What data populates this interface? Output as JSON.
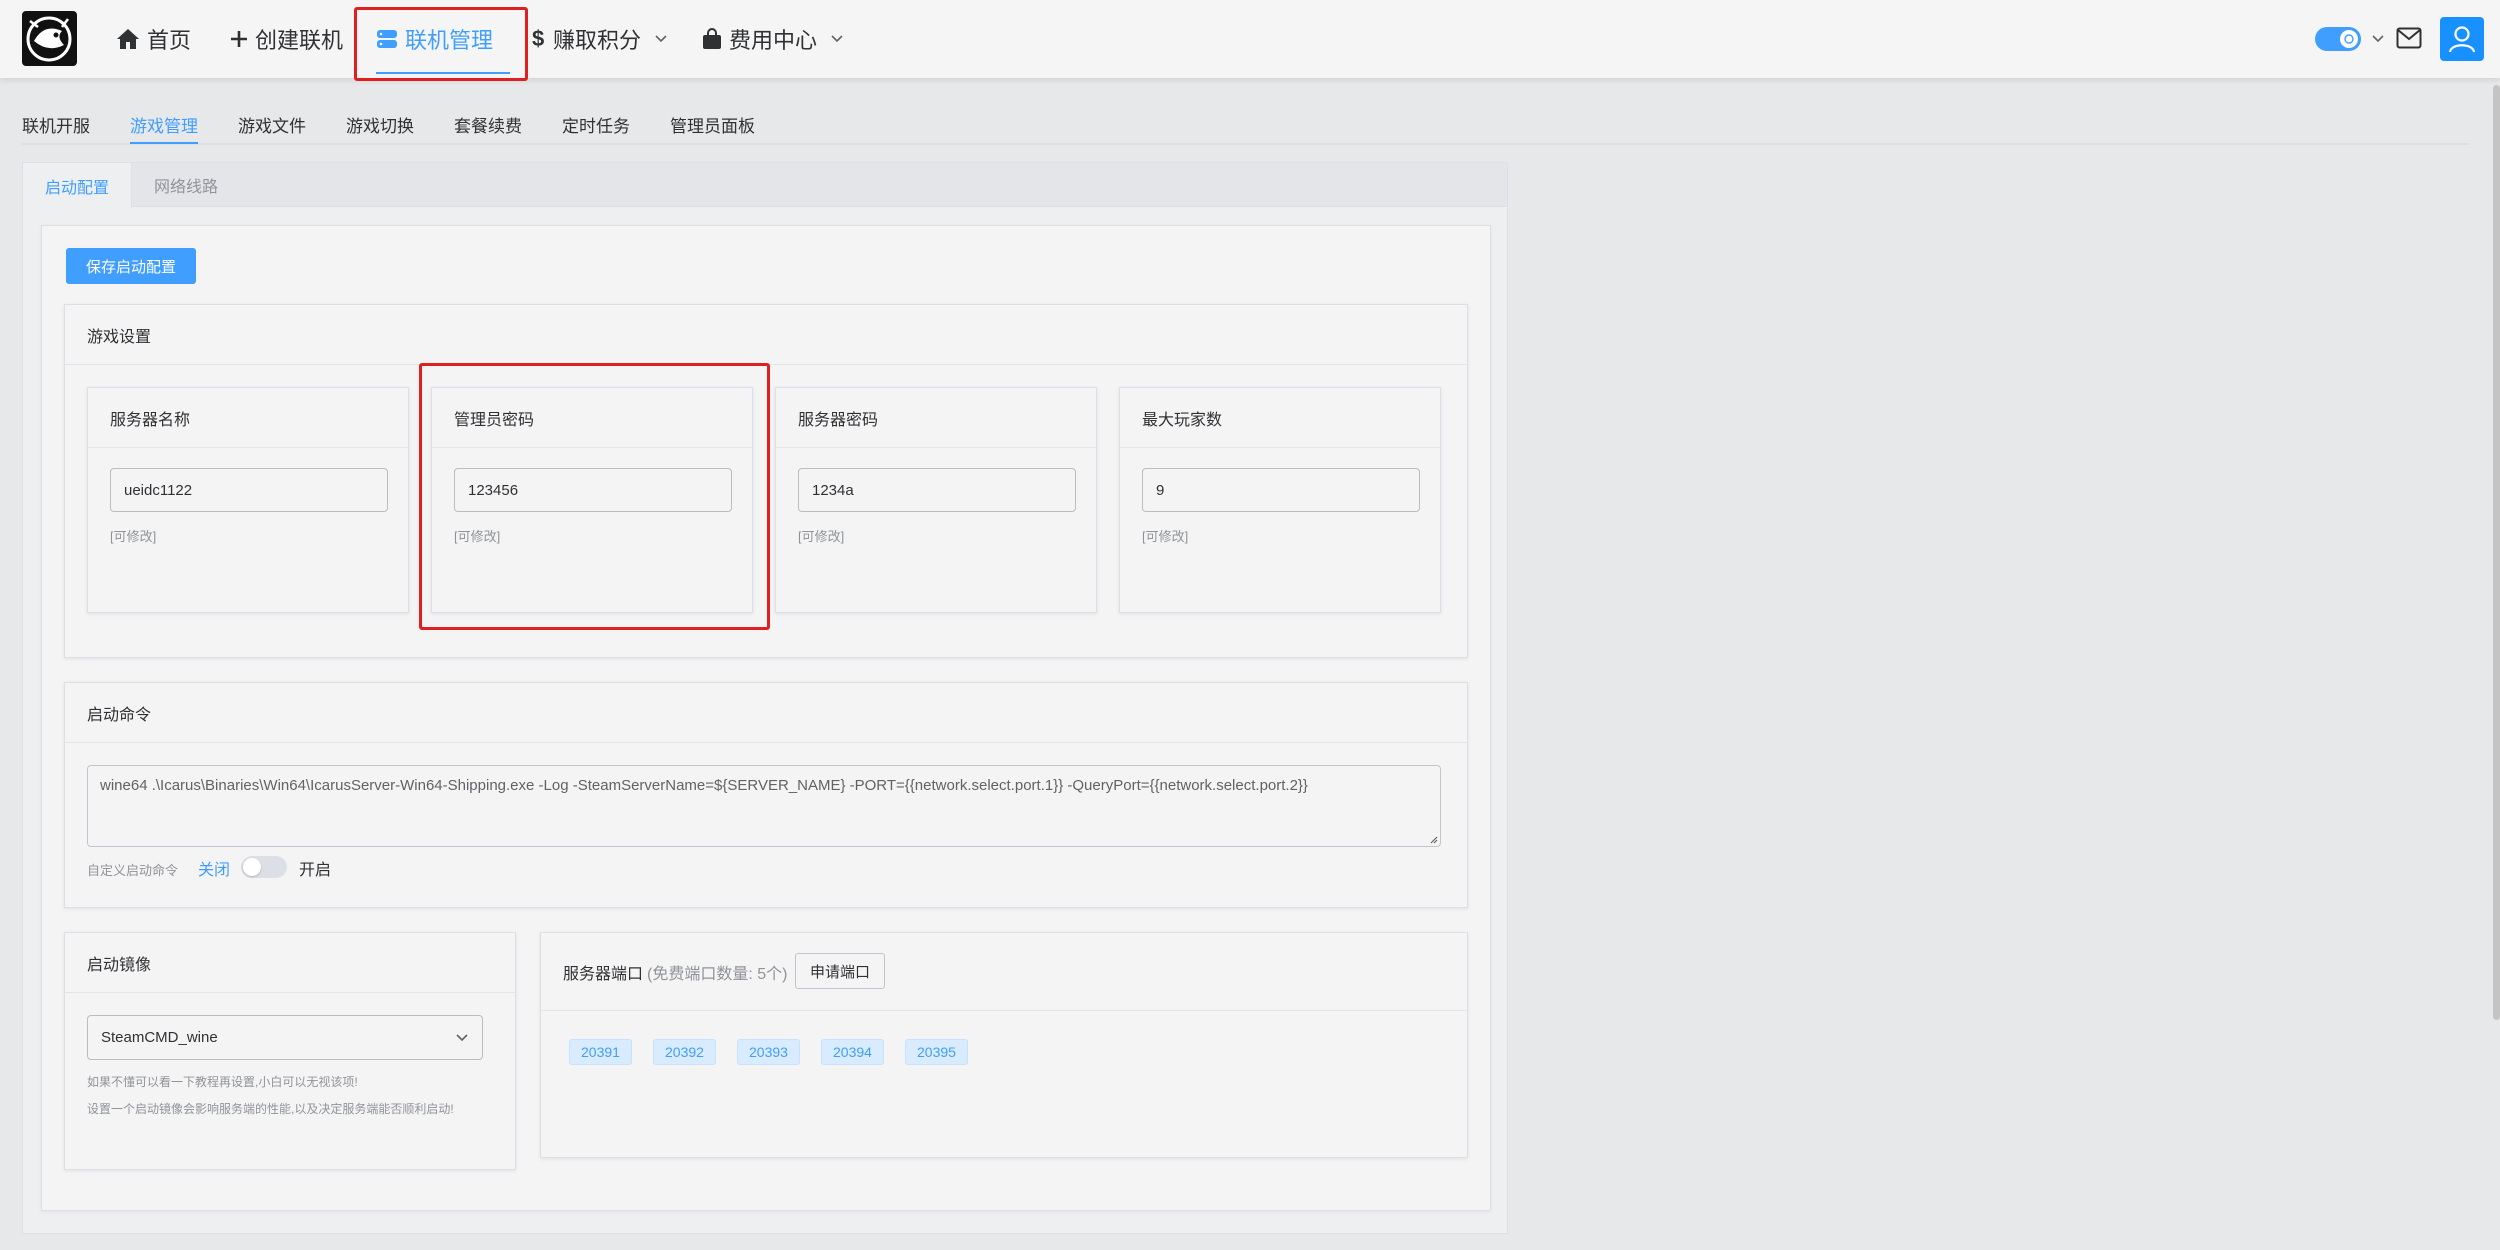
{
  "nav": {
    "home": "首页",
    "create": "创建联机",
    "manage": "联机管理",
    "earn": "赚取积分",
    "billing": "费用中心"
  },
  "subtabs": [
    "联机开服",
    "游戏管理",
    "游戏文件",
    "游戏切换",
    "套餐续费",
    "定时任务",
    "管理员面板"
  ],
  "card_tabs": [
    "启动配置",
    "网络线路"
  ],
  "save_button": "保存启动配置",
  "game_settings": {
    "title": "游戏设置",
    "fields": [
      {
        "label": "服务器名称",
        "value": "ueidc1122",
        "hint": "[可修改]"
      },
      {
        "label": "管理员密码",
        "value": "123456",
        "hint": "[可修改]"
      },
      {
        "label": "服务器密码",
        "value": "1234a",
        "hint": "[可修改]"
      },
      {
        "label": "最大玩家数",
        "value": "9",
        "hint": "[可修改]"
      }
    ]
  },
  "launch_command": {
    "title": "启动命令",
    "value": "wine64 .\\Icarus\\Binaries\\Win64\\IcarusServer-Win64-Shipping.exe -Log -SteamServerName=${SERVER_NAME} -PORT={{network.select.port.1}} -QueryPort={{network.select.port.2}}",
    "custom_label": "自定义启动命令",
    "off_label": "关闭",
    "on_label": "开启",
    "custom_enabled": false
  },
  "launch_image": {
    "title": "启动镜像",
    "selected": "SteamCMD_wine",
    "hint1": "如果不懂可以看一下教程再设置,小白可以无视该项!",
    "hint2": "设置一个启动镜像会影响服务端的性能,以及决定服务端能否顺利启动!"
  },
  "ports": {
    "title": "服务器端口",
    "subtitle": "(免费端口数量: 5个)",
    "apply_button": "申请端口",
    "list": [
      "20391",
      "20392",
      "20393",
      "20394",
      "20395"
    ]
  },
  "colors": {
    "accent": "#409eff",
    "highlight": "#e02020"
  }
}
